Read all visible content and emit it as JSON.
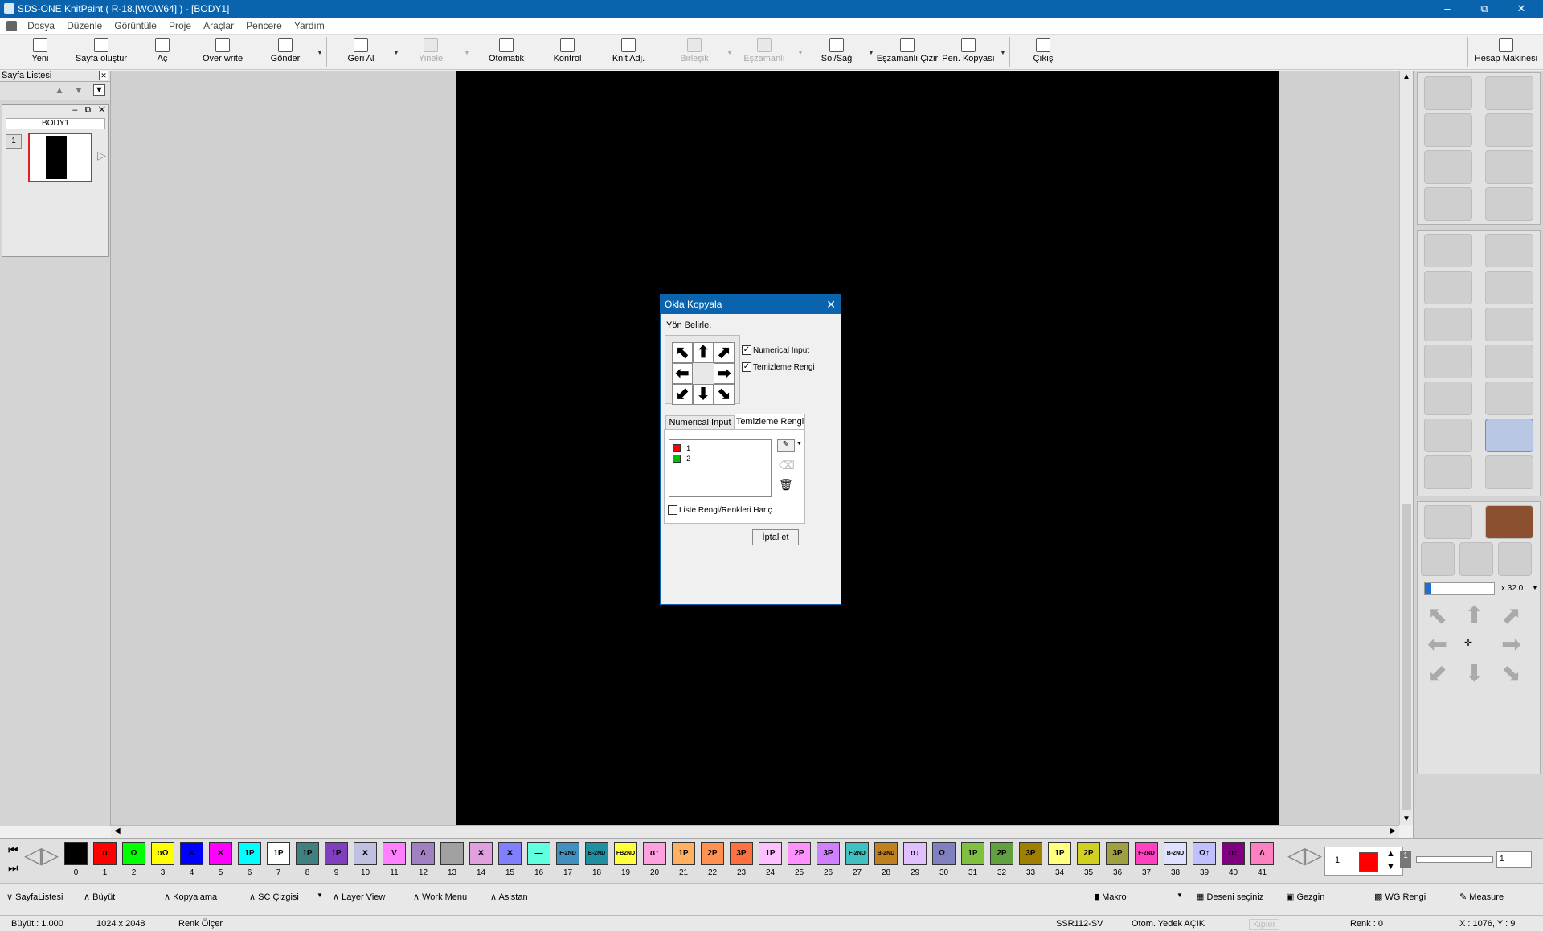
{
  "window": {
    "title": "SDS-ONE KnitPaint ( R-18.[WOW64] ) - [BODY1]"
  },
  "menu": [
    "Dosya",
    "Düzenle",
    "Görüntüle",
    "Proje",
    "Araçlar",
    "Pencere",
    "Yardım"
  ],
  "toolbar": {
    "new": "Yeni",
    "create_page": "Sayfa oluştur",
    "open": "Aç",
    "overwrite": "Over write",
    "send": "Gönder",
    "undo": "Geri Al",
    "redo": "Yinele",
    "auto": "Otomatik",
    "control": "Kontrol",
    "knit_adj": "Knit Adj.",
    "merge": "Birleşik",
    "sync": "Eşzamanlı",
    "left_right": "Sol/Sağ",
    "sync_draw": "Eşzamanlı Çizir",
    "win_copy": "Pen. Kopyası",
    "exit": "Çıkış",
    "calculator": "Hesap Makinesi"
  },
  "page_list": {
    "title": "Sayfa Listesi",
    "tab": "BODY1",
    "page_num": "1"
  },
  "dialog": {
    "title": "Okla Kopyala",
    "direction_label": "Yön Belirle.",
    "numerical_input": "Numerical Input",
    "clear_color": "Temizleme Rengi",
    "tab1": "Numerical Input",
    "tab2": "Temizleme Rengi",
    "list": [
      {
        "label": "1",
        "color": "#ff0000"
      },
      {
        "label": "2",
        "color": "#00c000"
      }
    ],
    "exclude": "Liste Rengi/Renkleri Hariç",
    "cancel": "İptal et"
  },
  "palette": {
    "swatches": [
      {
        "n": "0",
        "c": "#000000",
        "t": ""
      },
      {
        "n": "1",
        "c": "#ff0000",
        "t": "ʊ"
      },
      {
        "n": "2",
        "c": "#00ff00",
        "t": "Ω"
      },
      {
        "n": "3",
        "c": "#ffff00",
        "t": "ʊΩ"
      },
      {
        "n": "4",
        "c": "#0000ff",
        "t": "✕"
      },
      {
        "n": "5",
        "c": "#ff00ff",
        "t": "✕"
      },
      {
        "n": "6",
        "c": "#00ffff",
        "t": "1P"
      },
      {
        "n": "7",
        "c": "#ffffff",
        "t": "1P"
      },
      {
        "n": "8",
        "c": "#408080",
        "t": "1P"
      },
      {
        "n": "9",
        "c": "#7f3fbf",
        "t": "1P"
      },
      {
        "n": "10",
        "c": "#c0c0e0",
        "t": "✕"
      },
      {
        "n": "11",
        "c": "#ff80ff",
        "t": "V"
      },
      {
        "n": "12",
        "c": "#a080c0",
        "t": "Λ"
      },
      {
        "n": "13",
        "c": "#a0a0a0",
        "t": ""
      },
      {
        "n": "14",
        "c": "#e0a0e0",
        "t": "✕"
      },
      {
        "n": "15",
        "c": "#8080ff",
        "t": "✕"
      },
      {
        "n": "16",
        "c": "#60ffe0",
        "t": "—"
      },
      {
        "n": "17",
        "c": "#4090c0",
        "t": "F-2ND"
      },
      {
        "n": "18",
        "c": "#2090a0",
        "t": "B-2ND"
      },
      {
        "n": "19",
        "c": "#ffff40",
        "t": "FB2ND"
      },
      {
        "n": "20",
        "c": "#ffa0e0",
        "t": "ʊ↑"
      },
      {
        "n": "21",
        "c": "#ffb060",
        "t": "1P"
      },
      {
        "n": "22",
        "c": "#ff9050",
        "t": "2P"
      },
      {
        "n": "23",
        "c": "#ff7040",
        "t": "3P"
      },
      {
        "n": "24",
        "c": "#ffc0ff",
        "t": "1P"
      },
      {
        "n": "25",
        "c": "#ff90ff",
        "t": "2P"
      },
      {
        "n": "26",
        "c": "#d080ff",
        "t": "3P"
      },
      {
        "n": "27",
        "c": "#40c0c0",
        "t": "F-2ND"
      },
      {
        "n": "28",
        "c": "#c08020",
        "t": "B-2ND"
      },
      {
        "n": "29",
        "c": "#e0c0ff",
        "t": "ʊ↓"
      },
      {
        "n": "30",
        "c": "#8080c0",
        "t": "Ω↓"
      },
      {
        "n": "31",
        "c": "#80c040",
        "t": "1P"
      },
      {
        "n": "32",
        "c": "#60a040",
        "t": "2P"
      },
      {
        "n": "33",
        "c": "#a08000",
        "t": "3P"
      },
      {
        "n": "34",
        "c": "#ffff80",
        "t": "1P"
      },
      {
        "n": "35",
        "c": "#d0d020",
        "t": "2P"
      },
      {
        "n": "36",
        "c": "#a0a040",
        "t": "3P"
      },
      {
        "n": "37",
        "c": "#ff40c0",
        "t": "F-2ND"
      },
      {
        "n": "38",
        "c": "#e0e0ff",
        "t": "B-2ND"
      },
      {
        "n": "39",
        "c": "#c0c0ff",
        "t": "Ω↑"
      },
      {
        "n": "40",
        "c": "#800080",
        "t": "ʊ↑"
      },
      {
        "n": "41",
        "c": "#ff80c0",
        "t": "Λ"
      }
    ],
    "current_index": "1",
    "current_color": "#ff0000",
    "slider_value": "1",
    "zoom": "x 32.0"
  },
  "bottom_bar": [
    "SayfaListesi",
    "Büyüt",
    "Kopyalama",
    "SC Çizgisi",
    "Layer View",
    "Work Menu",
    "Asistan",
    "Makro",
    "Deseni seçiniz",
    "Gezgin",
    "WG Rengi",
    "Measure"
  ],
  "status": {
    "zoom": "Büyüt.: 1.000",
    "size": "1024 x 2048",
    "color_gauge": "Renk Ölçer",
    "machine": "SSR112-SV",
    "backup": "Otom. Yedek AÇIK",
    "lock": "Kipler",
    "color": "Renk : 0",
    "coords": "X : 1076, Y : 9"
  }
}
